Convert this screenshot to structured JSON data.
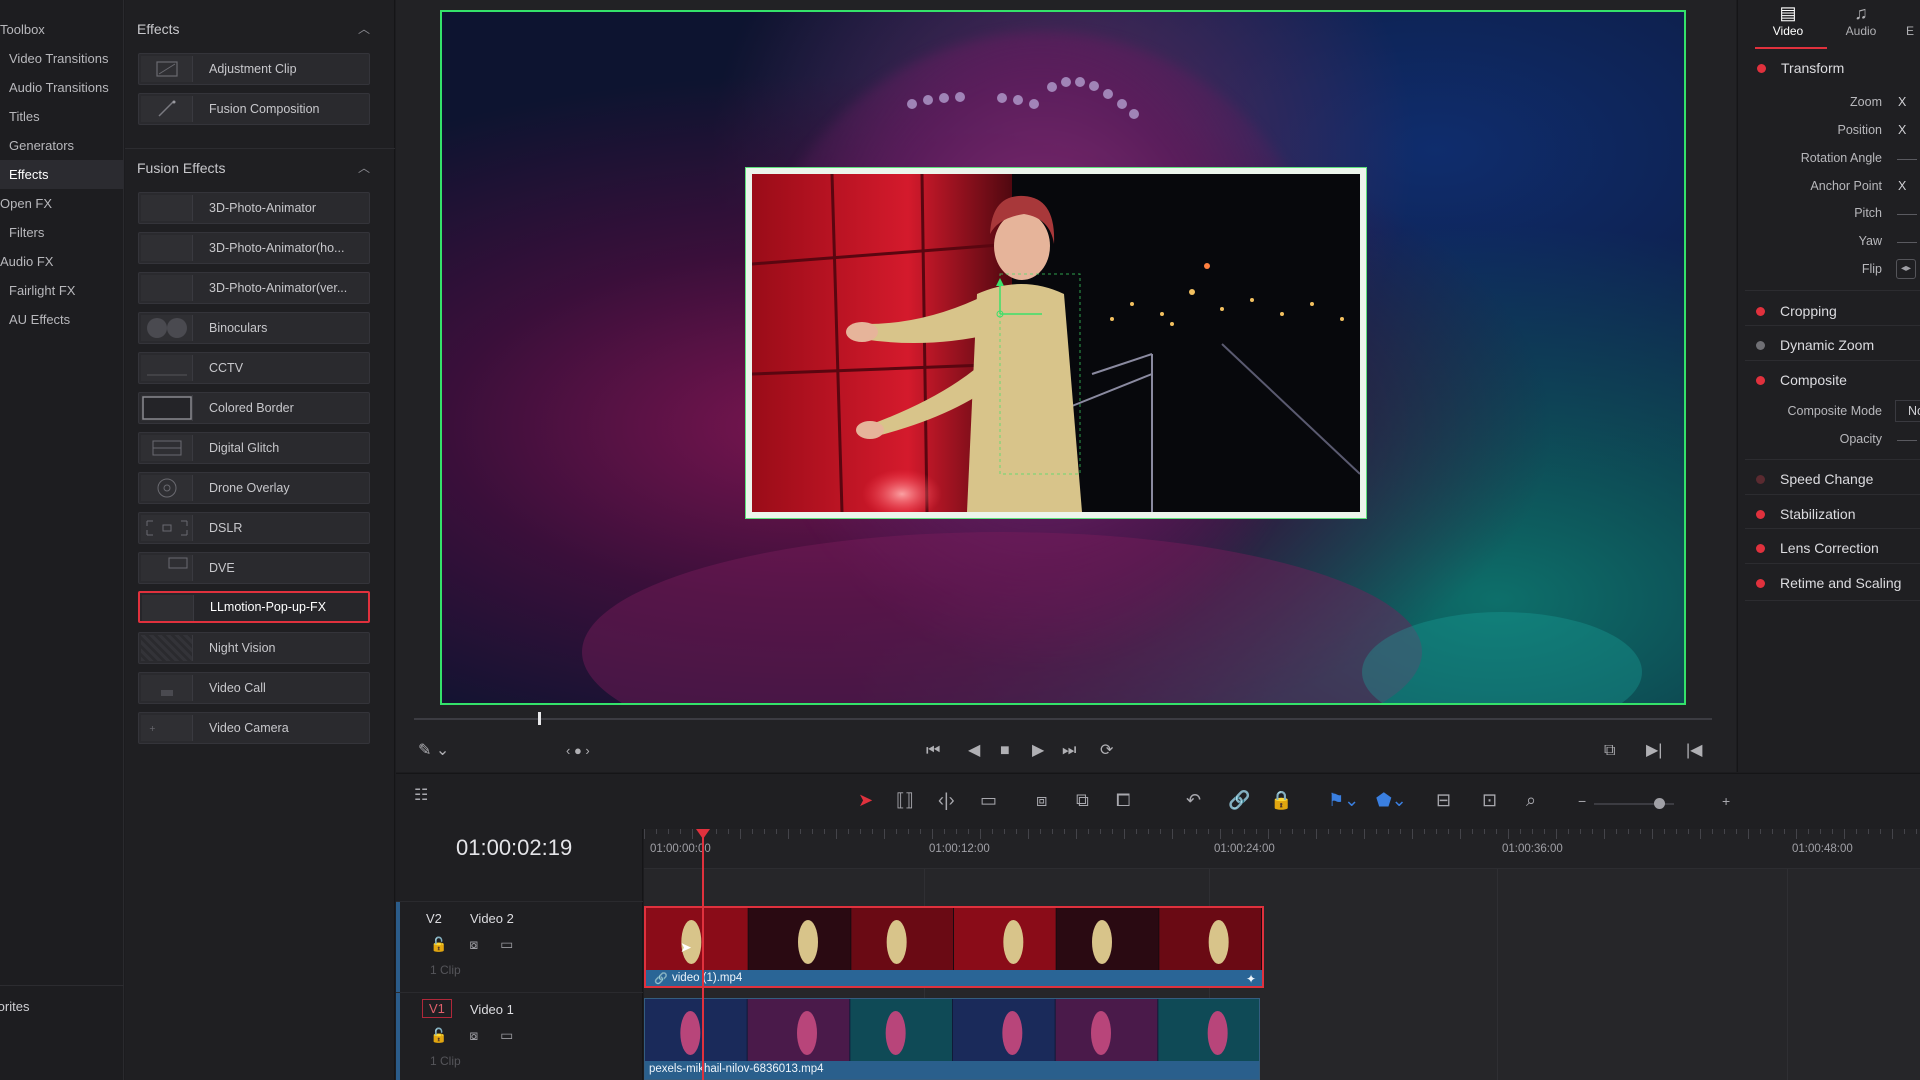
{
  "categories": {
    "items": [
      "Toolbox",
      "Video Transitions",
      "Audio Transitions",
      "Titles",
      "Generators",
      "Effects",
      "Open FX",
      "Filters",
      "Audio FX",
      "Fairlight FX",
      "AU Effects"
    ],
    "favorites": "Favorites"
  },
  "effects_panel": {
    "effects_header": "Effects",
    "effects_items": [
      "Adjustment Clip",
      "Fusion Composition"
    ],
    "fusion_header": "Fusion Effects",
    "fusion_items": [
      "3D-Photo-Animator",
      "3D-Photo-Animator(ho...",
      "3D-Photo-Animator(ver...",
      "Binoculars",
      "CCTV",
      "Colored Border",
      "Digital Glitch",
      "Drone Overlay",
      "DSLR",
      "DVE",
      "LLmotion-Pop-up-FX",
      "Night Vision",
      "Video Call",
      "Video Camera"
    ],
    "selected": "LLmotion-Pop-up-FX"
  },
  "inspector": {
    "tabs": [
      {
        "label": "Video",
        "icon": "film-icon"
      },
      {
        "label": "Audio",
        "icon": "music-note-icon"
      },
      {
        "label": "E",
        "icon": ""
      }
    ],
    "transform": {
      "title": "Transform",
      "rows": [
        {
          "label": "Zoom",
          "suffix": "X"
        },
        {
          "label": "Position",
          "suffix": "X"
        },
        {
          "label": "Rotation Angle",
          "suffix": ""
        },
        {
          "label": "Anchor Point",
          "suffix": "X"
        },
        {
          "label": "Pitch",
          "suffix": ""
        },
        {
          "label": "Yaw",
          "suffix": ""
        },
        {
          "label": "Flip",
          "suffix": ""
        }
      ]
    },
    "sections": [
      "Cropping",
      "Dynamic Zoom",
      "Composite"
    ],
    "composite_rows": [
      {
        "label": "Composite Mode",
        "value": "No"
      },
      {
        "label": "Opacity",
        "value": ""
      }
    ],
    "sections_2": [
      "Speed Change",
      "Stabilization",
      "Lens Correction",
      "Retime and Scaling"
    ]
  },
  "timeline": {
    "timecode": "01:00:02:19",
    "ruler": [
      "01:00:00:00",
      "01:00:12:00",
      "01:00:24:00",
      "01:00:36:00",
      "01:00:48:00"
    ],
    "tracks": [
      {
        "id": "V2",
        "name": "Video 2",
        "count": "1 Clip",
        "clip": "video (1).mp4"
      },
      {
        "id": "V1",
        "name": "Video 1",
        "count": "1 Clip",
        "clip": "pexels-mikhail-nilov-6836013.mp4"
      }
    ]
  },
  "colors": {
    "accent": "#e0313d",
    "selection_green": "#34e26a",
    "clip_blue": "#2a6596"
  }
}
